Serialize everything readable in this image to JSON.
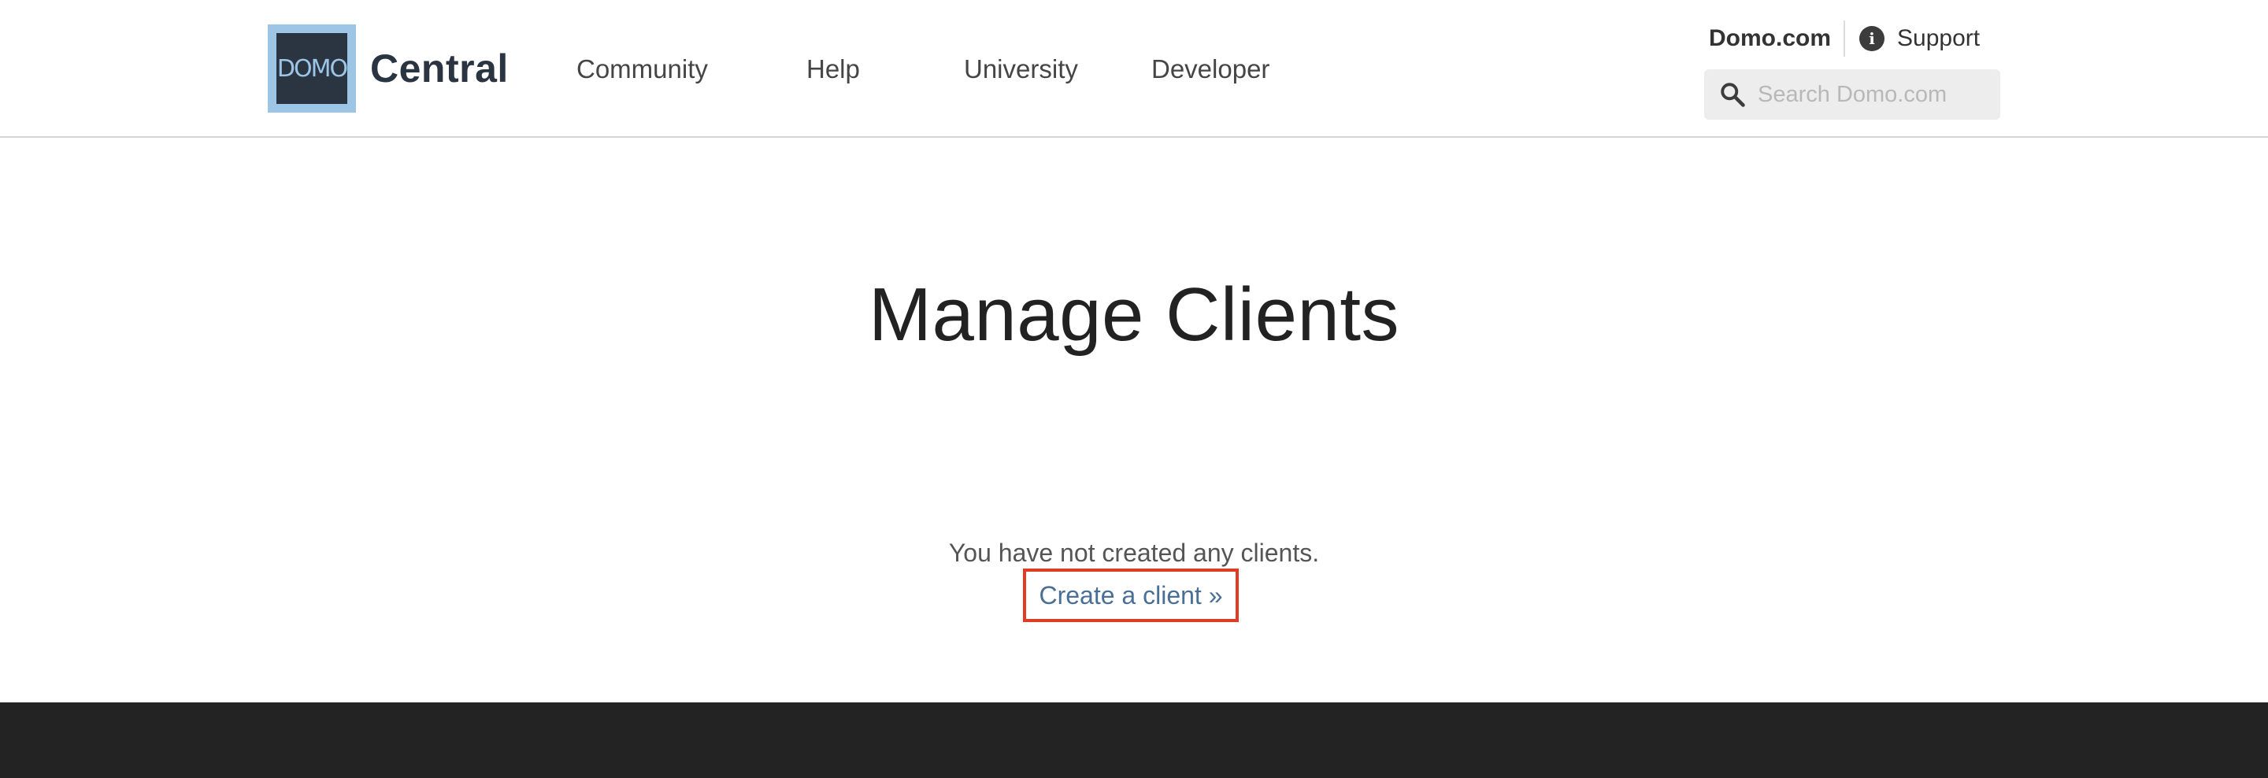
{
  "header": {
    "logo_text": "DOMO",
    "brand": "Central",
    "nav": [
      {
        "label": "Community"
      },
      {
        "label": "Help"
      },
      {
        "label": "University"
      },
      {
        "label": "Developer"
      }
    ],
    "utility": {
      "domo_link": "Domo.com",
      "support_label": "Support",
      "support_icon": "info-icon"
    },
    "search": {
      "placeholder": "Search Domo.com",
      "value": "",
      "icon": "search-icon"
    }
  },
  "main": {
    "title": "Manage Clients",
    "empty_message": "You have not created any clients.",
    "create_link": "Create a client »"
  },
  "colors": {
    "brand_dark": "#2b3542",
    "logo_frame": "#9cc5e6",
    "link": "#4a6f96",
    "highlight_border": "#e03c23",
    "footer": "#232323"
  }
}
